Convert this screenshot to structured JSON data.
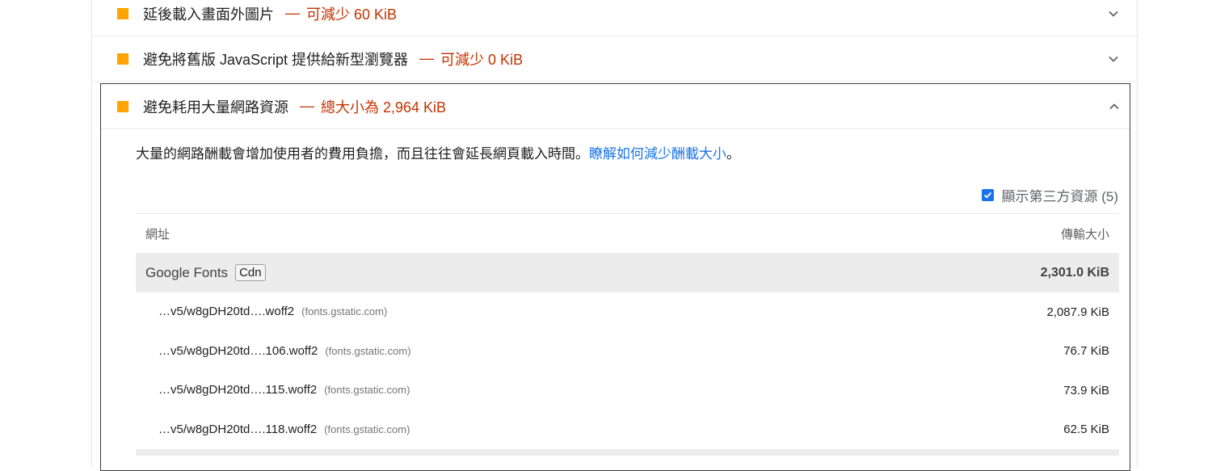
{
  "audits": [
    {
      "title": "延後載入畫面外圖片",
      "separator": "—",
      "savings": "可減少 60 KiB"
    },
    {
      "title": "避免將舊版 JavaScript 提供給新型瀏覽器",
      "separator": "—",
      "savings": "可減少 0 KiB"
    }
  ],
  "expanded_audit": {
    "title": "避免耗用大量網路資源",
    "separator": "—",
    "savings": "總大小為 2,964 KiB",
    "description": "大量的網路酬載會增加使用者的費用負擔，而且往往會延長網頁載入時間。",
    "learn_more_link": "瞭解如何減少酬載大小",
    "description_end": "。",
    "third_party_label": "顯示第三方資源 (5)",
    "third_party_checked": true,
    "table": {
      "col_url": "網址",
      "col_size": "傳輸大小",
      "group": {
        "name": "Google Fonts",
        "tag": "Cdn",
        "size": "2,301.0 KiB"
      },
      "rows": [
        {
          "url": "…v5/w8gDH20td….woff2",
          "host": "(fonts.gstatic.com)",
          "size": "2,087.9 KiB"
        },
        {
          "url": "…v5/w8gDH20td….106.woff2",
          "host": "(fonts.gstatic.com)",
          "size": "76.7 KiB"
        },
        {
          "url": "…v5/w8gDH20td….115.woff2",
          "host": "(fonts.gstatic.com)",
          "size": "73.9 KiB"
        },
        {
          "url": "…v5/w8gDH20td….118.woff2",
          "host": "(fonts.gstatic.com)",
          "size": "62.5 KiB"
        }
      ]
    }
  },
  "colors": {
    "warning_square": "#ffa400",
    "savings_text": "#c33300",
    "link": "#1a73e8",
    "group_bg": "#ececec"
  },
  "icons": {
    "collapsed": "chevron-down-icon",
    "expanded": "chevron-up-icon",
    "checkbox": "checkbox-checked-icon"
  }
}
